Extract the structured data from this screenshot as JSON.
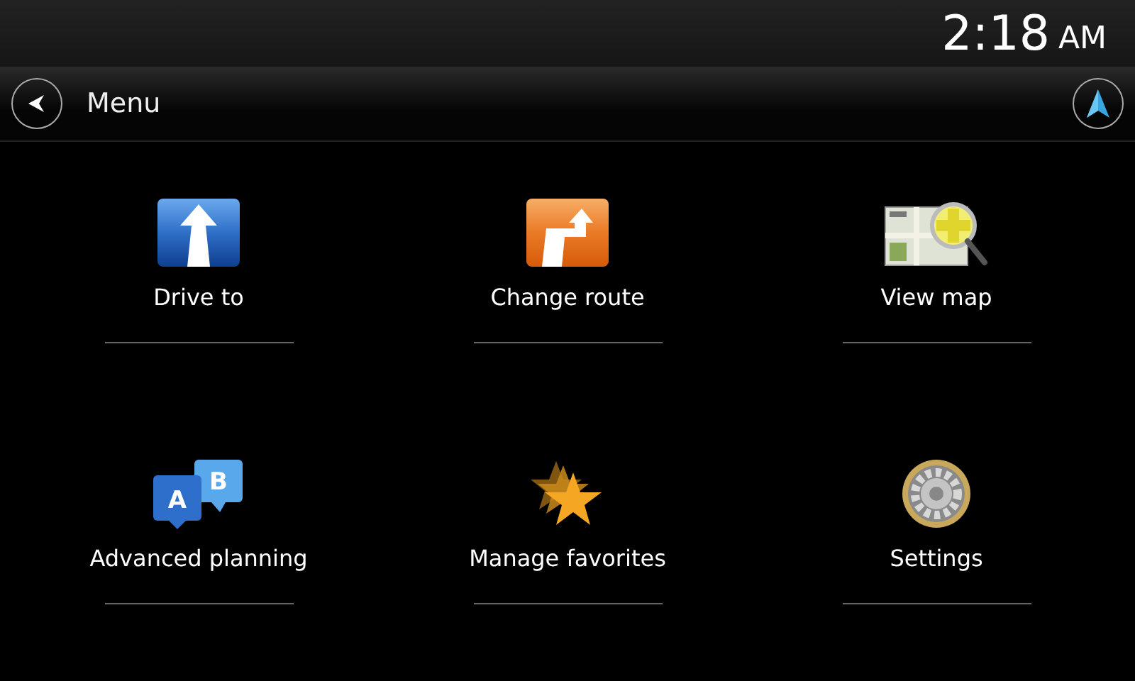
{
  "status_bar": {
    "time": "2:18",
    "meridiem": "AM"
  },
  "header": {
    "title": "Menu"
  },
  "menu_items": [
    {
      "label": "Drive to",
      "kind": "arrow"
    },
    {
      "label": "Change route",
      "kind": "detour"
    },
    {
      "label": "View map",
      "kind": "map"
    },
    {
      "label": "Advanced planning",
      "kind": "bubbles",
      "icon_letters": [
        "A",
        "B"
      ]
    },
    {
      "label": "Manage favorites",
      "kind": "star"
    },
    {
      "label": "Settings",
      "kind": "gear"
    }
  ]
}
